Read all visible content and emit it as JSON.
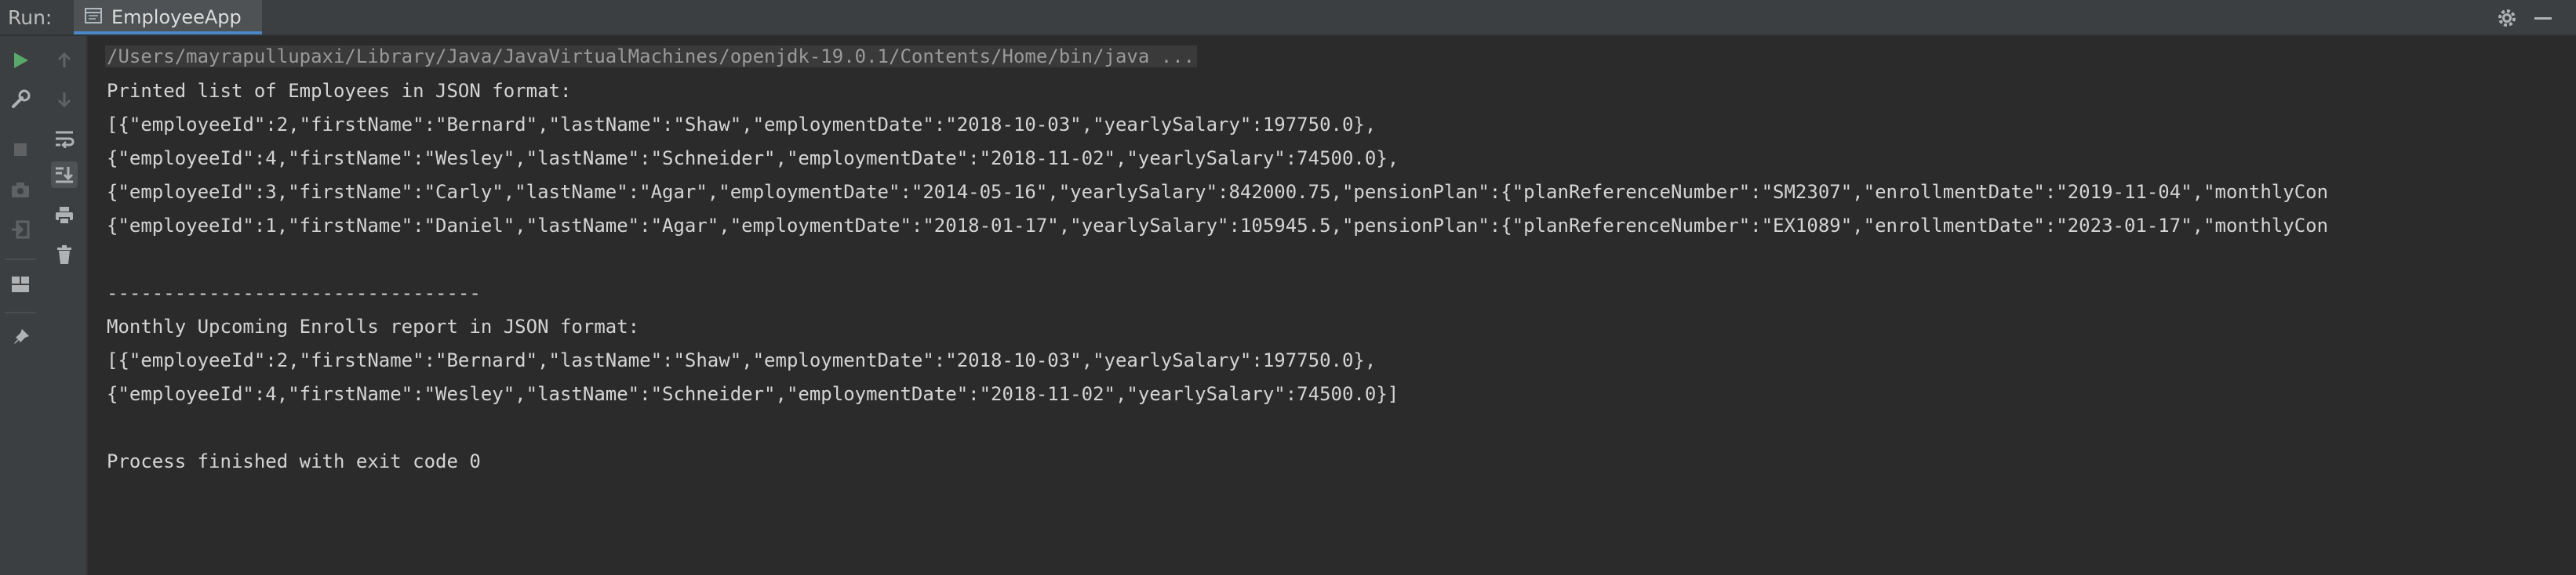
{
  "header": {
    "run_label": "Run:",
    "tab_label": "EmployeeApp",
    "tab_icon": "console-tab-icon"
  },
  "toolbar": {
    "outer_icons": [
      "rerun-icon",
      "wrench-icon",
      "stop-icon",
      "camera-icon",
      "exit-icon",
      "layout-icon",
      "pin-icon"
    ],
    "inner_icons": [
      "up-arrow-icon",
      "down-arrow-icon",
      "soft-wrap-icon",
      "scroll-to-end-icon",
      "print-icon",
      "trash-icon"
    ]
  },
  "console": {
    "command": "/Users/mayrapullupaxi/Library/Java/JavaVirtualMachines/openjdk-19.0.1/Contents/Home/bin/java ...",
    "lines": [
      "Printed list of Employees in JSON format:",
      "[{\"employeeId\":2,\"firstName\":\"Bernard\",\"lastName\":\"Shaw\",\"employmentDate\":\"2018-10-03\",\"yearlySalary\":197750.0},",
      "{\"employeeId\":4,\"firstName\":\"Wesley\",\"lastName\":\"Schneider\",\"employmentDate\":\"2018-11-02\",\"yearlySalary\":74500.0},",
      "{\"employeeId\":3,\"firstName\":\"Carly\",\"lastName\":\"Agar\",\"employmentDate\":\"2014-05-16\",\"yearlySalary\":842000.75,\"pensionPlan\":{\"planReferenceNumber\":\"SM2307\",\"enrollmentDate\":\"2019-11-04\",\"monthlyCon",
      "{\"employeeId\":1,\"firstName\":\"Daniel\",\"lastName\":\"Agar\",\"employmentDate\":\"2018-01-17\",\"yearlySalary\":105945.5,\"pensionPlan\":{\"planReferenceNumber\":\"EX1089\",\"enrollmentDate\":\"2023-01-17\",\"monthlyCon",
      "",
      "---------------------------------",
      "Monthly Upcoming Enrolls report in JSON format:",
      "[{\"employeeId\":2,\"firstName\":\"Bernard\",\"lastName\":\"Shaw\",\"employmentDate\":\"2018-10-03\",\"yearlySalary\":197750.0},",
      "{\"employeeId\":4,\"firstName\":\"Wesley\",\"lastName\":\"Schneider\",\"employmentDate\":\"2018-11-02\",\"yearlySalary\":74500.0}]",
      "",
      "Process finished with exit code 0"
    ]
  },
  "colors": {
    "background": "#2b2b2b",
    "toolbar": "#3c3f41",
    "run_green": "#59a869",
    "tab_underline": "#4a88c7"
  }
}
